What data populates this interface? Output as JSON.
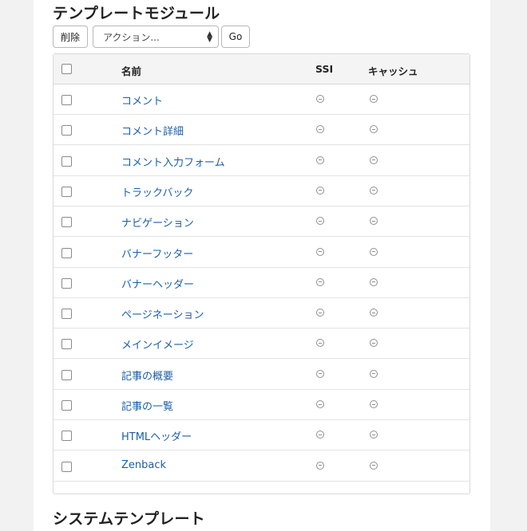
{
  "section_title": "テンプレートモジュール",
  "next_section_title": "システムテンプレート",
  "actions": {
    "delete_label": "削除",
    "select_value": "アクション...",
    "go_label": "Go"
  },
  "table": {
    "headers": {
      "name": "名前",
      "ssi": "SSI",
      "cache": "キャッシュ"
    },
    "rows": [
      {
        "name": "コメント",
        "ssi": "off",
        "cache": "off"
      },
      {
        "name": "コメント詳細",
        "ssi": "off",
        "cache": "off"
      },
      {
        "name": "コメント入力フォーム",
        "ssi": "off",
        "cache": "off"
      },
      {
        "name": "トラックバック",
        "ssi": "off",
        "cache": "off"
      },
      {
        "name": "ナビゲーション",
        "ssi": "off",
        "cache": "off"
      },
      {
        "name": "バナーフッター",
        "ssi": "off",
        "cache": "off"
      },
      {
        "name": "バナーヘッダー",
        "ssi": "off",
        "cache": "off"
      },
      {
        "name": "ページネーション",
        "ssi": "off",
        "cache": "off"
      },
      {
        "name": "メインイメージ",
        "ssi": "off",
        "cache": "off"
      },
      {
        "name": "記事の概要",
        "ssi": "off",
        "cache": "off"
      },
      {
        "name": "記事の一覧",
        "ssi": "off",
        "cache": "off"
      },
      {
        "name": "HTMLヘッダー",
        "ssi": "off",
        "cache": "off"
      },
      {
        "name": "Zenback",
        "ssi": "off",
        "cache": "off"
      }
    ]
  },
  "colors": {
    "link": "#1b5fa8",
    "header_bg": "#f4f4f4",
    "border": "#d9d9d9"
  },
  "icons": {
    "status_off": "minus-circle-icon",
    "select_arrow": "updown-caret-icon"
  }
}
